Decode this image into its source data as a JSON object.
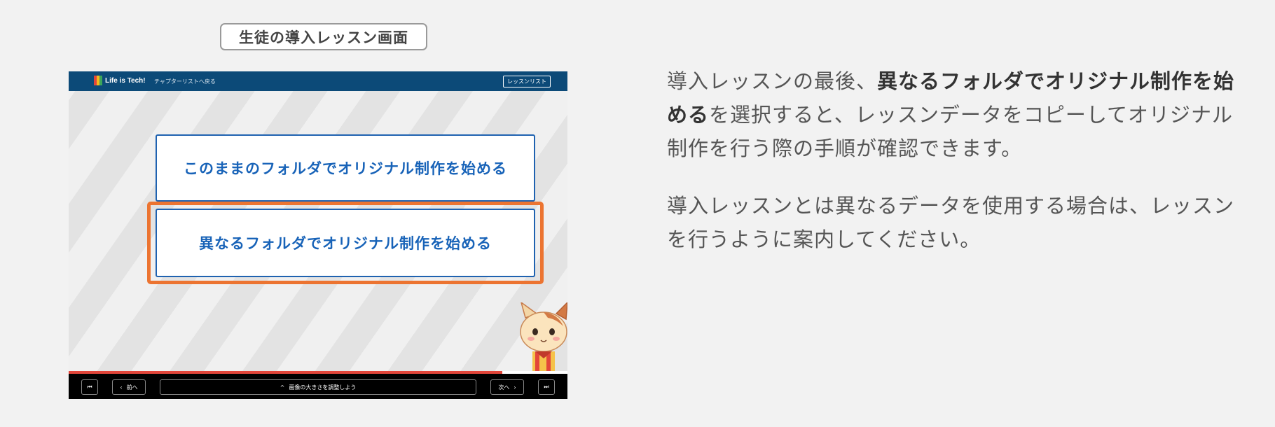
{
  "caption": "生徒の導入レッスン画面",
  "screen": {
    "logo_text": "Life is Tech!",
    "back_link": "チャプターリストへ戻る",
    "lesson_list_button": "レッスンリスト",
    "option_same_folder": "このままのフォルダでオリジナル制作を始める",
    "option_different_folder": "異なるフォルダでオリジナル制作を始める",
    "progress": 0.87,
    "controls": {
      "prev_label": "前へ",
      "next_label": "次へ",
      "current_title": "画像の大きさを調整しよう"
    }
  },
  "description": {
    "p1_before": "導入レッスンの最後、",
    "p1_bold": "異なるフォルダでオリジナル制作を始める",
    "p1_after": "を選択すると、レッスンデータをコピーしてオリジナル制作を行う際の手順が確認できます。",
    "p2": "導入レッスンとは異なるデータを使用する場合は、レッスンを行うように案内してください。"
  },
  "colors": {
    "highlight": "#ec7431",
    "option_text": "#1863b8",
    "topbar": "#0c4a78",
    "progress": "#e2463a"
  },
  "icons": [
    "skip-first-icon",
    "chevron-left-icon",
    "chevron-up-icon",
    "chevron-right-icon",
    "skip-last-icon",
    "cat-mascot"
  ]
}
